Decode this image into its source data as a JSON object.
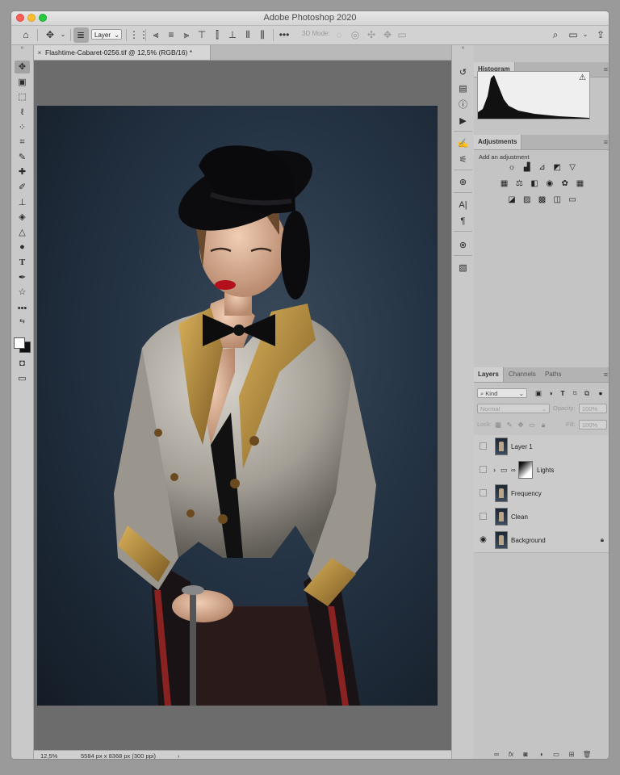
{
  "window": {
    "title": "Adobe Photoshop 2020"
  },
  "options_bar": {
    "auto_select_target": "Layer",
    "mode_3d_label": "3D Mode:"
  },
  "document": {
    "tab_title": "Flashtime-Cabaret-0256.tif @ 12,5% (RGB/16) *",
    "zoom": "12,5%",
    "doc_info": "5584 px x 8368 px (300 ppi)"
  },
  "histogram": {
    "tab_label": "Histogram"
  },
  "adjustments": {
    "tab_label": "Adjustments",
    "prompt": "Add an adjustment"
  },
  "layers_panel": {
    "tabs": [
      "Layers",
      "Channels",
      "Paths"
    ],
    "filter_kind": "Kind",
    "blend_mode": "Normal",
    "opacity_label": "Opacity:",
    "opacity_value": "100%",
    "lock_label": "Lock:",
    "fill_label": "Fill:",
    "fill_value": "100%",
    "layers": [
      {
        "name": "Layer 1",
        "visible": false
      },
      {
        "name": "Lights",
        "visible": false,
        "type": "group"
      },
      {
        "name": "Frequency",
        "visible": false
      },
      {
        "name": "Clean",
        "visible": false
      },
      {
        "name": "Background",
        "visible": true,
        "locked": true
      }
    ]
  },
  "colors": {
    "canvas_bg": "#6c6c6c",
    "panel_bg": "#c4c4c4",
    "foreground_swatch": "#ffffff",
    "background_swatch": "#111111"
  }
}
